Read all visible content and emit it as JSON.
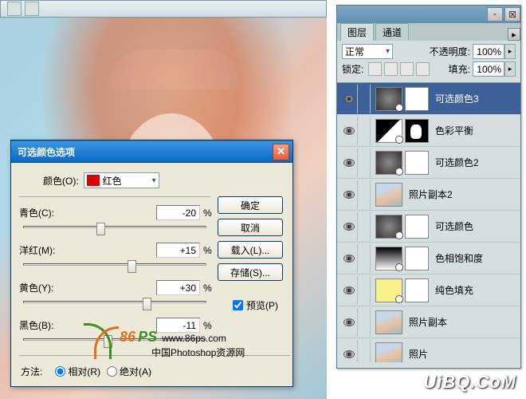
{
  "dialog": {
    "title": "可选颜色选项",
    "color_label": "颜色(O):",
    "color_name": "红色",
    "sliders": {
      "cyan": {
        "label": "青色(C):",
        "value": "-20",
        "pos": 40
      },
      "magenta": {
        "label": "洋红(M):",
        "value": "+15",
        "pos": 57
      },
      "yellow": {
        "label": "黄色(Y):",
        "value": "+30",
        "pos": 65
      },
      "black": {
        "label": "黑色(B):",
        "value": "-11",
        "pos": 44
      }
    },
    "percent": "%",
    "method_label": "方法:",
    "relative": "相对(R)",
    "absolute": "绝对(A)",
    "buttons": {
      "ok": "确定",
      "cancel": "取消",
      "load": "载入(L)...",
      "save": "存储(S)..."
    },
    "preview": "预览(P)"
  },
  "layers_panel": {
    "tabs": {
      "layers": "图层",
      "channels": "通道"
    },
    "blend_mode": "正常",
    "opacity_label": "不透明度:",
    "opacity_value": "100%",
    "lock_label": "锁定:",
    "fill_label": "填充:",
    "fill_value": "100%",
    "layers": [
      {
        "name": "可选颜色3",
        "type": "adj",
        "selected": true,
        "mask": "white"
      },
      {
        "name": "色彩平衡",
        "type": "adj2",
        "mask": "black"
      },
      {
        "name": "可选颜色2",
        "type": "adj",
        "mask": "white"
      },
      {
        "name": "照片副本2",
        "type": "photo"
      },
      {
        "name": "可选颜色",
        "type": "adj",
        "mask": "white"
      },
      {
        "name": "色相饱和度",
        "type": "grad",
        "mask": "white"
      },
      {
        "name": "纯色填充",
        "type": "solid-yellow",
        "mask": "white"
      },
      {
        "name": "照片副本",
        "type": "photo"
      },
      {
        "name": "照片",
        "type": "photo"
      }
    ]
  },
  "watermark": {
    "logo_text": "86",
    "site": "www.86ps.com",
    "desc": "中国Photoshop资源网",
    "uibq": "UiBQ.CoM"
  }
}
